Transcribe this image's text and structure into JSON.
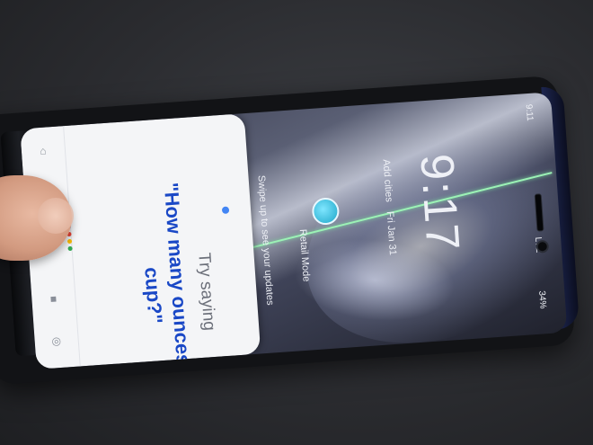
{
  "assistant": {
    "try_text": "Try saying",
    "question": "\"How many ounces in a cup?\"",
    "dot_colors": [
      "#4285F4",
      "#EA4335",
      "#FBBC05",
      "#34A853"
    ]
  },
  "lockscreen": {
    "time": "9:17",
    "add_cities": "Add cities",
    "date": "Fri Jan 31",
    "swipe_hint": "Swipe up to see your updates",
    "app_label": "Retail Mode"
  },
  "status_bar": {
    "time": "9:11",
    "network": "LTE",
    "battery": "34%"
  },
  "icons": [
    "back-icon",
    "home-icon",
    "recents-icon",
    "assistant-icon",
    "compass-icon",
    "retail-mode-app-icon"
  ]
}
